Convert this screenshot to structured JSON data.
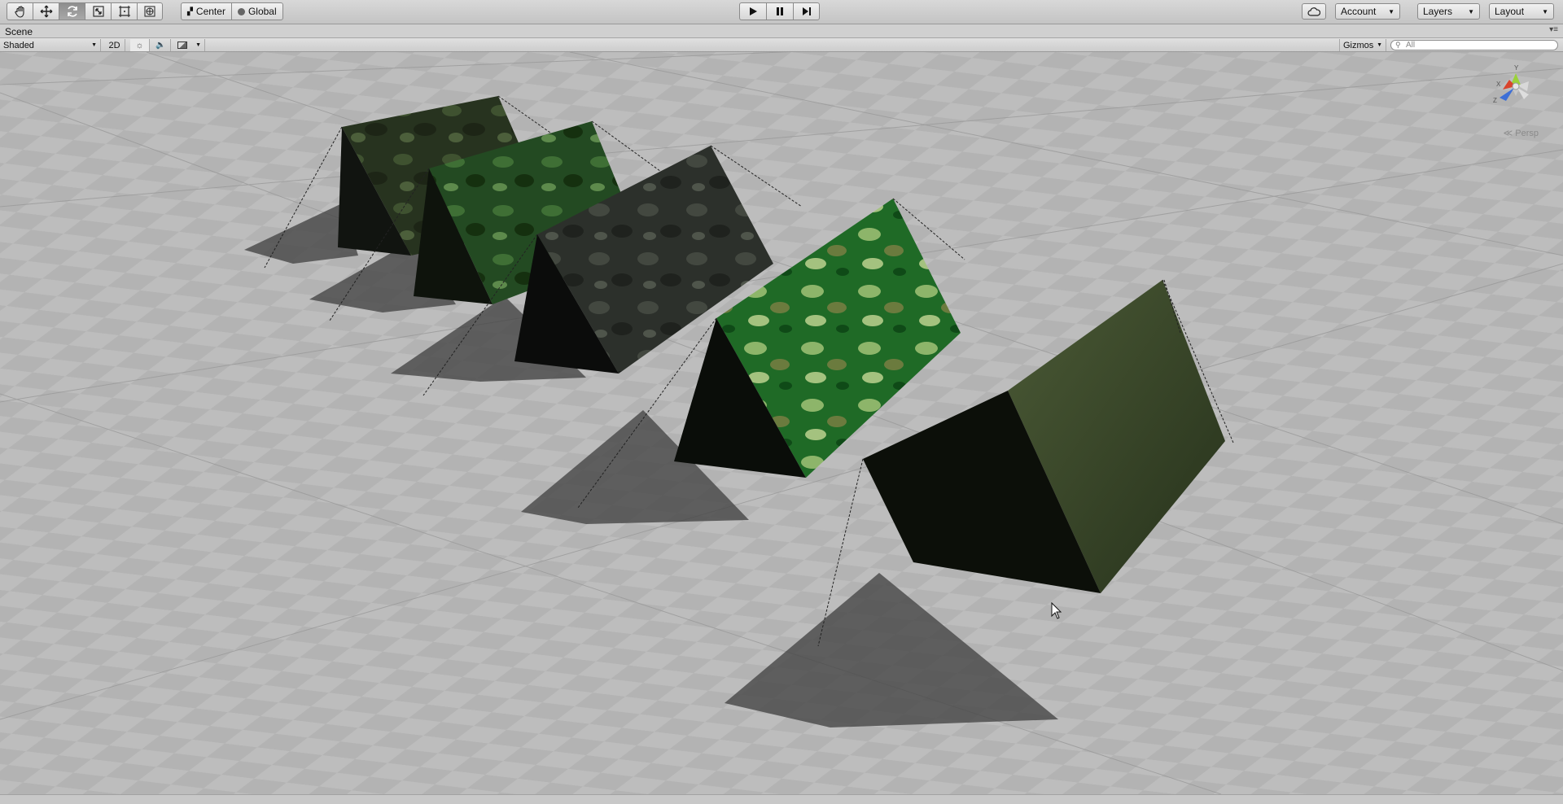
{
  "toolbar": {
    "tools": [
      {
        "name": "hand-tool",
        "icon": "hand-icon"
      },
      {
        "name": "move-tool",
        "icon": "move-arrows-icon"
      },
      {
        "name": "rotate-tool",
        "icon": "rotate-icon"
      },
      {
        "name": "scale-tool",
        "icon": "scale-icon"
      },
      {
        "name": "rect-tool",
        "icon": "rect-icon"
      },
      {
        "name": "transform-tool",
        "icon": "transform-icon"
      }
    ],
    "active_tool": "rotate-tool",
    "pivot_mode_label": "Center",
    "pivot_rotation_label": "Global",
    "play_controls": [
      "play",
      "pause",
      "step"
    ],
    "account_label": "Account",
    "layers_label": "Layers",
    "layout_label": "Layout"
  },
  "scene_tab": {
    "title": "Scene"
  },
  "scene_toolbar": {
    "draw_mode": "Shaded",
    "mode_2d_label": "2D",
    "gizmos_label": "Gizmos",
    "search_placeholder": "All"
  },
  "viewport": {
    "projection_label": "Persp",
    "gizmo_axes": {
      "y": "Y",
      "x": "X",
      "z": "Z"
    },
    "background_color": "#b9b9b9",
    "objects": [
      {
        "name": "tent-1",
        "texture": "dark green camouflage"
      },
      {
        "name": "tent-2",
        "texture": "green camouflage"
      },
      {
        "name": "tent-3",
        "texture": "grey camouflage"
      },
      {
        "name": "tent-4",
        "texture": "bright green camouflage"
      },
      {
        "name": "tent-5",
        "texture": "olive canvas"
      }
    ]
  }
}
